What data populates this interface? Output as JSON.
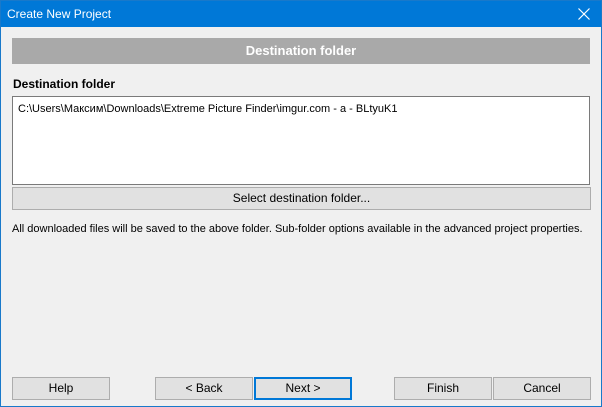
{
  "window": {
    "title": "Create New Project"
  },
  "header": {
    "title": "Destination folder"
  },
  "destination": {
    "label": "Destination folder",
    "path": "C:\\Users\\Максим\\Downloads\\Extreme Picture Finder\\imgur.com - a - BLtyuK1",
    "select_button": "Select destination folder..."
  },
  "info": {
    "text": "All downloaded files will be saved to the above folder. Sub-folder options available in the advanced project properties."
  },
  "buttons": {
    "help": "Help",
    "back": "< Back",
    "next": "Next >",
    "finish": "Finish",
    "cancel": "Cancel"
  },
  "icons": {
    "close": "close-icon"
  },
  "colors": {
    "titlebar": "#0078d7",
    "header_band": "#a9a9a9",
    "default_button_border": "#0078d7"
  }
}
